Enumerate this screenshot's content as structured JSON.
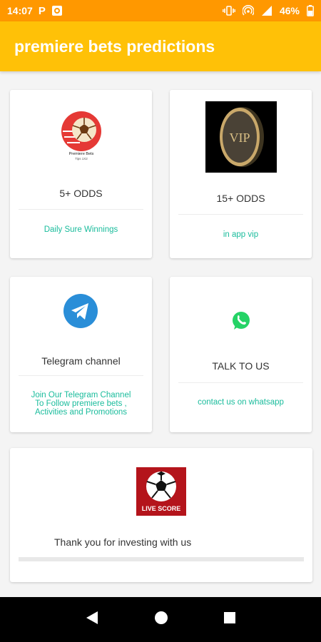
{
  "status_bar": {
    "time": "14:07",
    "battery": "46%",
    "icons": [
      "p-notification-icon",
      "camera-app-icon",
      "vibrate-icon",
      "hotspot-icon",
      "signal-icon",
      "battery-icon"
    ]
  },
  "app_bar": {
    "title": "premiere bets predictions"
  },
  "cards": {
    "odds5": {
      "logo_text": "Premiere Bets",
      "logo_subtext": "Tips 1X2",
      "title": "5+ ODDS",
      "link": "Daily Sure Winnings"
    },
    "odds15": {
      "logo_text": "VIP",
      "title": "15+ ODDS",
      "link": "in app vip"
    },
    "telegram": {
      "title": "Telegram channel",
      "link_line1": "Join Our Telegram Channel",
      "link_line2": "To Follow premiere bets ,",
      "link_line3": "Activities and Promotions"
    },
    "whatsapp": {
      "title": "TALK TO US",
      "link": "contact us on whatsapp"
    },
    "livescore": {
      "logo_text": "LIVE SCORE",
      "message": "Thank you for investing with us"
    }
  },
  "colors": {
    "status_bar": "#ff9800",
    "app_bar": "#ffc107",
    "link": "#1abc9c",
    "telegram": "#2a8ed8",
    "whatsapp": "#25d366",
    "livescore": "#b4141b"
  },
  "nav_bar": {
    "buttons": [
      "back",
      "home",
      "recents"
    ]
  }
}
